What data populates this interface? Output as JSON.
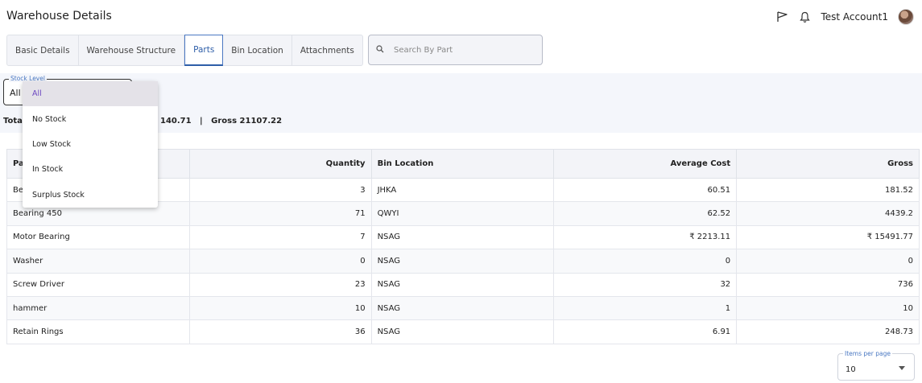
{
  "header": {
    "title": "Warehouse Details",
    "account_name": "Test Account1",
    "icons": [
      "flag-icon",
      "bell-icon",
      "avatar"
    ]
  },
  "tabs": [
    {
      "label": "Basic Details",
      "active": false
    },
    {
      "label": "Warehouse Structure",
      "active": false
    },
    {
      "label": "Parts",
      "active": true
    },
    {
      "label": "Bin Location",
      "active": false
    },
    {
      "label": "Attachments",
      "active": false
    }
  ],
  "search": {
    "placeholder": "Search By Part",
    "value": ""
  },
  "stock_level": {
    "label": "Stock Level",
    "value": "All",
    "options": [
      "All",
      "No Stock",
      "Low Stock",
      "In Stock",
      "Surplus Stock"
    ],
    "selected_index": 0
  },
  "totals": {
    "left": "Tota",
    "right": "140.71   |   Gross 21107.22"
  },
  "table": {
    "columns": [
      "Pa",
      "Quantity",
      "Bin Location",
      "Average Cost",
      "Gross"
    ],
    "rows": [
      {
        "part": "Be",
        "quantity": "3",
        "bin": "JHKA",
        "avg_cost": "60.51",
        "gross": "181.52"
      },
      {
        "part": "Bearing 450",
        "quantity": "71",
        "bin": "QWYI",
        "avg_cost": "62.52",
        "gross": "4439.2"
      },
      {
        "part": "Motor Bearing",
        "quantity": "7",
        "bin": "NSAG",
        "avg_cost": "₹ 2213.11",
        "gross": "₹ 15491.77"
      },
      {
        "part": "Washer",
        "quantity": "0",
        "bin": "NSAG",
        "avg_cost": "0",
        "gross": "0"
      },
      {
        "part": "Screw Driver",
        "quantity": "23",
        "bin": "NSAG",
        "avg_cost": "32",
        "gross": "736"
      },
      {
        "part": "hammer",
        "quantity": "10",
        "bin": "NSAG",
        "avg_cost": "1",
        "gross": "10"
      },
      {
        "part": "Retain Rings",
        "quantity": "36",
        "bin": "NSAG",
        "avg_cost": "6.91",
        "gross": "248.73"
      }
    ]
  },
  "pagination": {
    "label": "Items per page",
    "value": "10"
  },
  "colors": {
    "accent": "#2e5ea8",
    "link": "#3a6fb4",
    "selected_option": "#6b46c1"
  }
}
